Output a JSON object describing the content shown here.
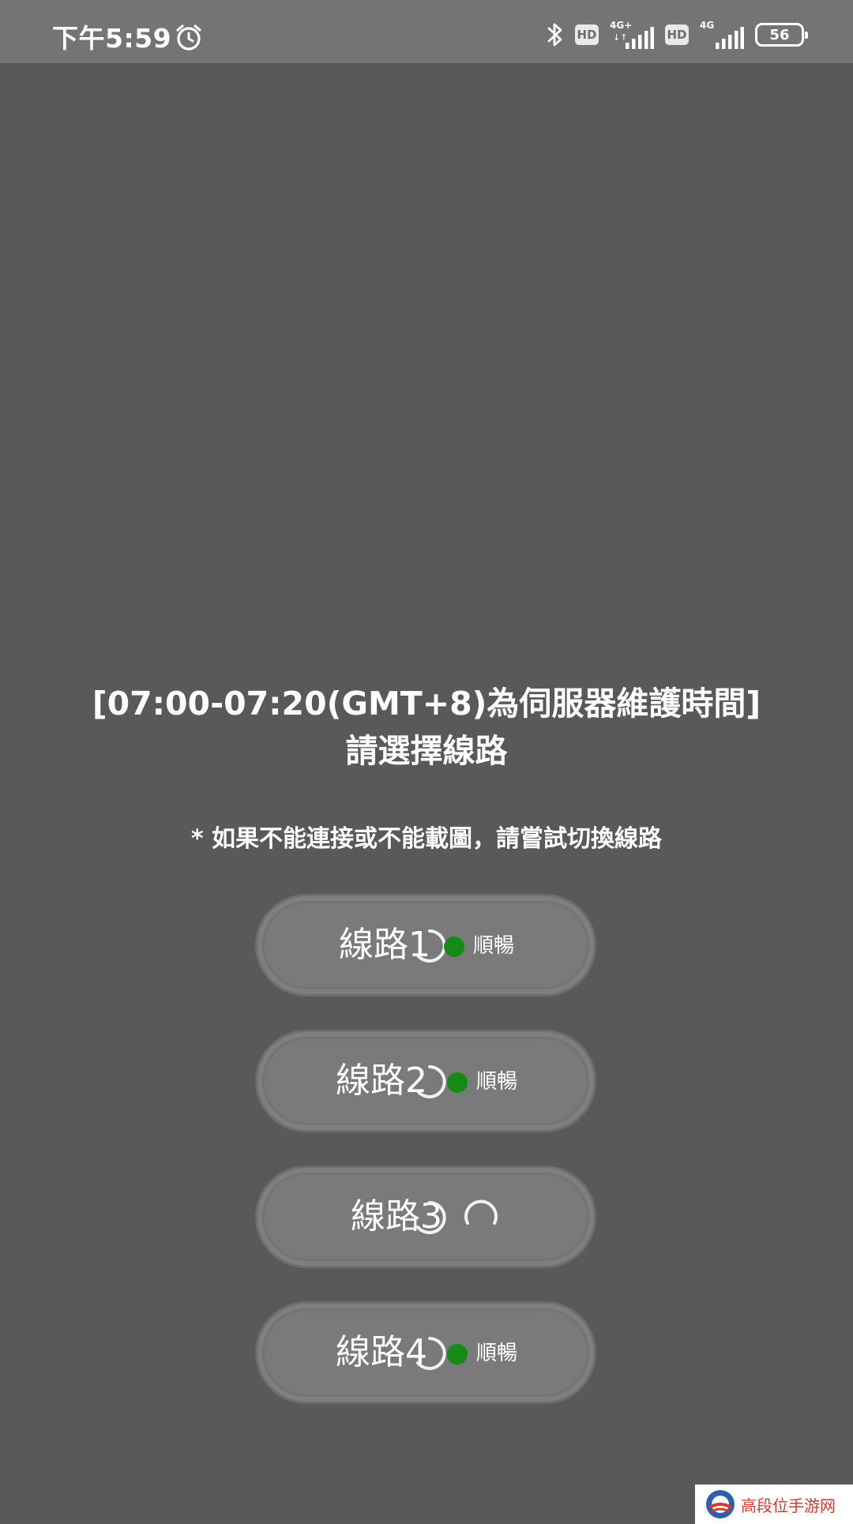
{
  "status_bar": {
    "time": "下午5:59",
    "hd1": "HD",
    "net1": "4G+",
    "net1_arrows": "↓↑",
    "hd2": "HD",
    "net2": "4G",
    "battery": "56"
  },
  "main": {
    "notice": "[07:00-07:20(GMT+8)為伺服器維護時間]",
    "choose": "請選擇線路",
    "hint": "* 如果不能連接或不能載圖，請嘗試切換線路"
  },
  "routes": [
    {
      "label": "線路1",
      "status": "順暢"
    },
    {
      "label": "線路2",
      "status": "順暢"
    },
    {
      "label": "線路3",
      "status": ""
    },
    {
      "label": "線路4",
      "status": "順暢"
    }
  ],
  "colors": {
    "background": "#595959",
    "status_bar": "#747474",
    "button": "#7a7a7a",
    "ok_dot": "#158a15"
  },
  "watermark": {
    "text": "高段位手游网"
  }
}
